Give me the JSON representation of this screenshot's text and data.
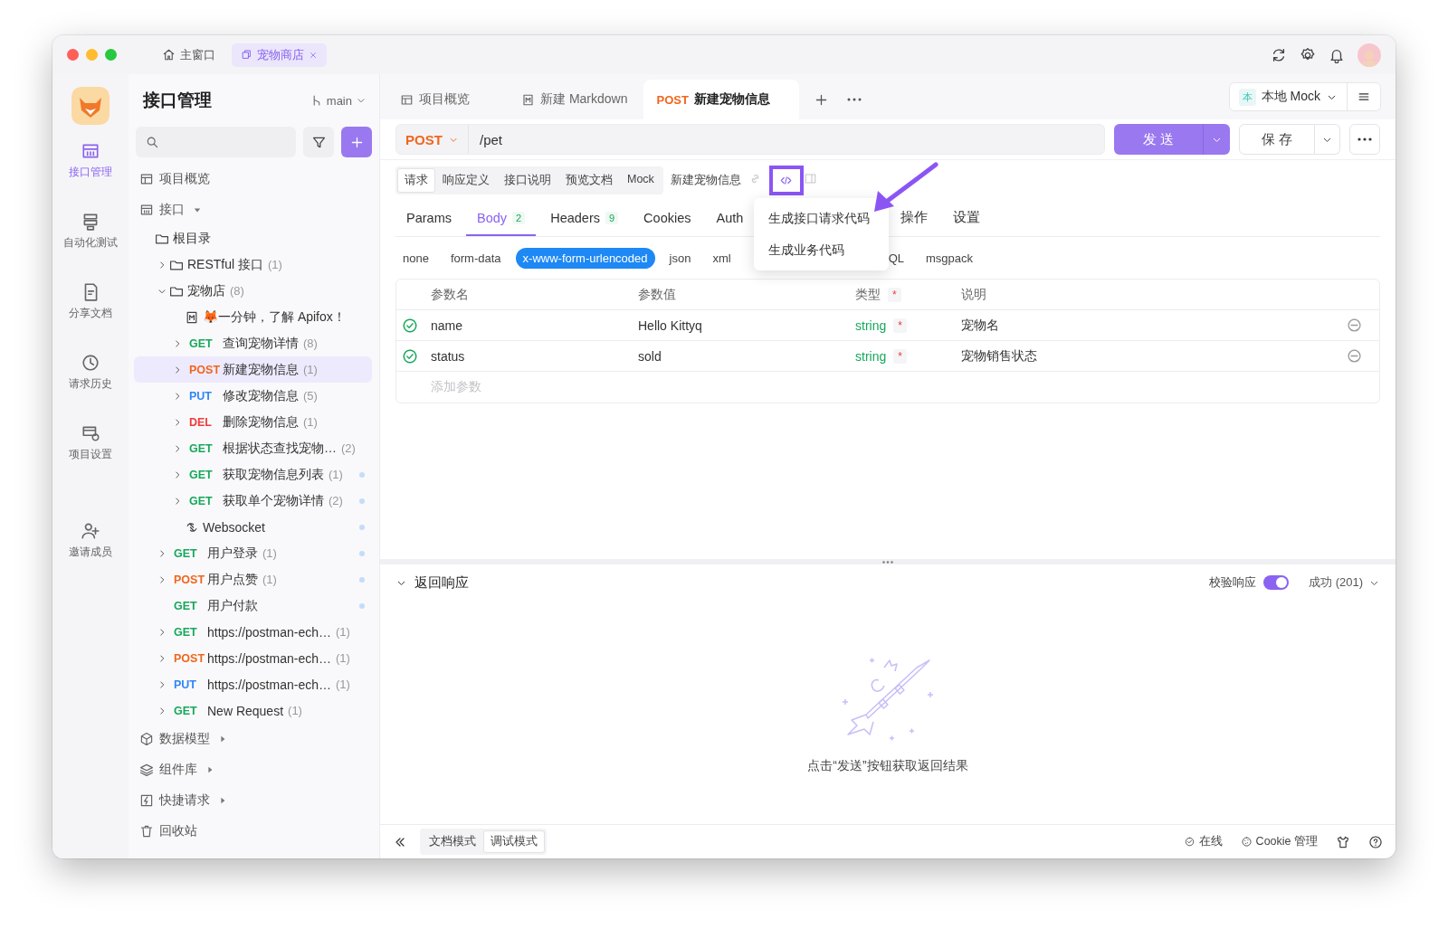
{
  "window": {
    "tabs": [
      {
        "label": "主窗口",
        "selected": false,
        "closable": false
      },
      {
        "label": "宠物商店",
        "selected": true,
        "closable": true
      }
    ]
  },
  "rail": [
    {
      "label": "接口管理",
      "selected": true
    },
    {
      "label": "自动化测试",
      "selected": false
    },
    {
      "label": "分享文档",
      "selected": false
    },
    {
      "label": "请求历史",
      "selected": false
    },
    {
      "label": "项目设置",
      "selected": false
    },
    {
      "label": "邀请成员",
      "selected": false
    }
  ],
  "sidebar": {
    "title": "接口管理",
    "branch": "main",
    "tree": [
      {
        "kind": "section",
        "label": "项目概览"
      },
      {
        "kind": "section",
        "label": "接口",
        "expanded": true,
        "children": [
          {
            "kind": "folder",
            "label": "根目录",
            "selected": false,
            "children": [
              {
                "kind": "folder",
                "label": "RESTful 接口",
                "count": "(1)",
                "expanded": false,
                "selected": false
              },
              {
                "kind": "folder",
                "label": "宠物店",
                "count": "(8)",
                "expanded": true,
                "selected": false,
                "children": [
                  {
                    "kind": "doc",
                    "label": "🦊一分钟，了解 Apifox！",
                    "selected": false
                  },
                  {
                    "kind": "endpoint",
                    "method": "GET",
                    "color": "#17a85b",
                    "label": "查询宠物详情",
                    "count": "(8)",
                    "expanded": false,
                    "selected": false,
                    "dot": false
                  },
                  {
                    "kind": "endpoint",
                    "method": "POST",
                    "color": "#f0661d",
                    "label": "新建宠物信息",
                    "count": "(1)",
                    "expanded": false,
                    "selected": true,
                    "dot": false
                  },
                  {
                    "kind": "endpoint",
                    "method": "PUT",
                    "color": "#2f86f6",
                    "label": "修改宠物信息",
                    "count": "(5)",
                    "expanded": false,
                    "selected": false,
                    "dot": false
                  },
                  {
                    "kind": "endpoint",
                    "method": "DEL",
                    "color": "#ef3b3b",
                    "label": "删除宠物信息",
                    "count": "(1)",
                    "expanded": false,
                    "selected": false,
                    "dot": false
                  },
                  {
                    "kind": "endpoint",
                    "method": "GET",
                    "color": "#17a85b",
                    "label": "根据状态查找宠物…",
                    "count": "(2)",
                    "expanded": false,
                    "selected": false,
                    "dot": false
                  },
                  {
                    "kind": "endpoint",
                    "method": "GET",
                    "color": "#17a85b",
                    "label": "获取宠物信息列表",
                    "count": "(1)",
                    "expanded": false,
                    "selected": false,
                    "dot": true
                  },
                  {
                    "kind": "endpoint",
                    "method": "GET",
                    "color": "#17a85b",
                    "label": "获取单个宠物详情",
                    "count": "(2)",
                    "expanded": false,
                    "selected": false,
                    "dot": true
                  },
                  {
                    "kind": "websocket",
                    "label": "Websocket",
                    "selected": false,
                    "dot": true
                  }
                ]
              },
              {
                "kind": "endpoint",
                "method": "GET",
                "color": "#17a85b",
                "label": "用户登录",
                "count": "(1)",
                "expanded": false,
                "selected": false,
                "dot": true
              },
              {
                "kind": "endpoint",
                "method": "POST",
                "color": "#f0661d",
                "label": "用户点赞",
                "count": "(1)",
                "expanded": false,
                "selected": false,
                "dot": true
              },
              {
                "kind": "endpoint",
                "method": "GET",
                "color": "#17a85b",
                "label": "用户付款",
                "selected": false,
                "dot": true
              },
              {
                "kind": "endpoint",
                "method": "GET",
                "color": "#17a85b",
                "label": "https://postman-ech…",
                "count": "(1)",
                "expanded": false,
                "selected": false,
                "dot": false
              },
              {
                "kind": "endpoint",
                "method": "POST",
                "color": "#f0661d",
                "label": "https://postman-ech…",
                "count": "(1)",
                "expanded": false,
                "selected": false,
                "dot": false
              },
              {
                "kind": "endpoint",
                "method": "PUT",
                "color": "#2f86f6",
                "label": "https://postman-ech…",
                "count": "(1)",
                "expanded": false,
                "selected": false,
                "dot": false
              },
              {
                "kind": "endpoint",
                "method": "GET",
                "color": "#17a85b",
                "label": "New Request",
                "count": "(1)",
                "expanded": false,
                "selected": false,
                "dot": false
              }
            ]
          }
        ]
      },
      {
        "kind": "section",
        "label": "数据模型",
        "expanded": false
      },
      {
        "kind": "section",
        "label": "组件库",
        "expanded": false
      },
      {
        "kind": "section",
        "label": "快捷请求",
        "expanded": false
      },
      {
        "kind": "section",
        "label": "回收站"
      }
    ]
  },
  "tabs": [
    {
      "kind": "page",
      "label": "项目概览",
      "selected": false
    },
    {
      "kind": "markdown",
      "label": "新建 Markdown",
      "selected": false
    },
    {
      "kind": "endpoint",
      "method": "POST",
      "color": "#f0661d",
      "label": "新建宠物信息",
      "selected": true
    }
  ],
  "environment": {
    "badge": "本",
    "label": "本地 Mock"
  },
  "request": {
    "method": "POST",
    "color": "#f0661d",
    "path": "/pet"
  },
  "send_button": "发 送",
  "save_button": "保 存",
  "doc_tabs": [
    {
      "label": "请求",
      "selected": true
    },
    {
      "label": "响应定义",
      "selected": false
    },
    {
      "label": "接口说明",
      "selected": false
    },
    {
      "label": "预览文档",
      "selected": false
    },
    {
      "label": "Mock",
      "selected": false
    }
  ],
  "endpoint_name": "新建宠物信息",
  "code_button": {
    "highlighted": true
  },
  "code_menu": [
    "生成接口请求代码",
    "生成业务代码"
  ],
  "param_tabs": [
    {
      "label": "Params",
      "selected": false
    },
    {
      "label": "Body",
      "count": "2",
      "selected": true
    },
    {
      "label": "Headers",
      "count": "9",
      "selected": false
    },
    {
      "label": "Cookies",
      "selected": false
    },
    {
      "label": "Auth",
      "selected": false
    },
    {
      "label": "操作",
      "selected": false
    },
    {
      "label": "设置",
      "selected": false
    }
  ],
  "body_types": [
    {
      "label": "none",
      "selected": false
    },
    {
      "label": "form-data",
      "selected": false
    },
    {
      "label": "x-www-form-urlencoded",
      "selected": true
    },
    {
      "label": "json",
      "selected": false
    },
    {
      "label": "xml",
      "selected": false
    },
    {
      "label": "QL",
      "selected": false
    },
    {
      "label": "msgpack",
      "selected": false
    }
  ],
  "params_table": {
    "columns": [
      {
        "label": "参数名"
      },
      {
        "label": "参数值"
      },
      {
        "label": "类型",
        "mark": "*"
      },
      {
        "label": "说明"
      }
    ],
    "rows": [
      {
        "enabled": true,
        "name": "name",
        "value": "Hello Kittyq",
        "type": "string",
        "required": "*",
        "description": "宠物名"
      },
      {
        "enabled": true,
        "name": "status",
        "value": "sold",
        "type": "string",
        "required": "*",
        "description": "宠物销售状态"
      }
    ],
    "placeholder": "添加参数"
  },
  "response": {
    "title": "返回响应",
    "expanded": true,
    "validate": {
      "label": "校验响应",
      "on": true
    },
    "status": "成功 (201)",
    "empty_text": "点击“发送”按钮获取返回结果"
  },
  "status_bar": {
    "modes": [
      {
        "label": "文档模式",
        "selected": false
      },
      {
        "label": "调试模式",
        "selected": true
      }
    ],
    "online": "在线",
    "cookie": "Cookie 管理"
  }
}
